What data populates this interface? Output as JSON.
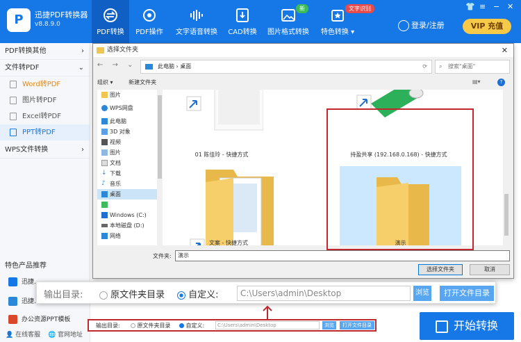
{
  "app": {
    "name": "迅捷PDF转换器",
    "version": "v8.8.9.0"
  },
  "nav": [
    {
      "label": "PDF转换",
      "icon": "swap-icon",
      "active": true
    },
    {
      "label": "PDF操作",
      "icon": "gear-icon"
    },
    {
      "label": "文字语音转换",
      "icon": "waveform-icon"
    },
    {
      "label": "CAD转换",
      "icon": "cad-icon"
    },
    {
      "label": "图片格式转换",
      "icon": "image-icon",
      "badge": "新"
    },
    {
      "label": "特色转换",
      "icon": "star-icon",
      "badge": "文字识别"
    }
  ],
  "header": {
    "login": "登录/注册",
    "vip": "VIP 充值"
  },
  "sidebar": {
    "sections": [
      {
        "label": "PDF转换其他"
      },
      {
        "label": "文件转PDF"
      },
      {
        "label": "WPS文件转换"
      }
    ],
    "items": [
      "Word转PDF",
      "图片转PDF",
      "Excel转PDF",
      "PPT转PDF"
    ],
    "featured_title": "特色产品推荐",
    "featured": [
      "迅捷...",
      "迅捷...",
      "办公资源PPT模板"
    ],
    "bottom": {
      "service": "在线客服",
      "website": "官网地址"
    }
  },
  "dialog": {
    "title": "选择文件夹",
    "breadcrumb": [
      "此电脑",
      "桌面"
    ],
    "search_placeholder": "搜索\"桌面\"",
    "organize": "组织 ▾",
    "new_folder": "新建文件夹",
    "tree": [
      "图片",
      "WPS网盘",
      "此电脑",
      "3D 对象",
      "视频",
      "图片",
      "文档",
      "下载",
      "音乐",
      "桌面",
      "",
      "Windows (C:)",
      "本地磁盘 (D:)",
      "网络"
    ],
    "files": [
      {
        "name": "01 陈佳玲 - 快捷方式"
      },
      {
        "name": "持盈共享 (192.168.0.168) - 快捷方式"
      },
      {
        "name": "文案 - 快捷方式"
      },
      {
        "name": "演示"
      }
    ],
    "folder_label": "文件夹:",
    "folder_value": "演示",
    "select_button": "选择文件夹",
    "cancel_button": "取消"
  },
  "output": {
    "label": "输出目录:",
    "option_original": "原文件夹目录",
    "option_custom": "自定义:",
    "path": "C:\\Users\\admin\\Desktop",
    "browse": "浏览",
    "open_folder": "打开文件目录"
  },
  "start_button": "开始转换",
  "colors": {
    "primary": "#1677e6",
    "highlight": "#c0282d",
    "vip": "#f7c948"
  }
}
